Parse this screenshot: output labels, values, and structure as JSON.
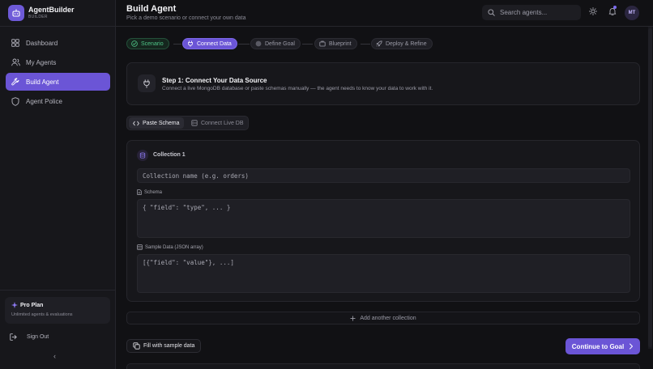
{
  "brand": {
    "name": "AgentBuilder",
    "subtitle": "BUILDER"
  },
  "sidebar": {
    "items": [
      {
        "label": "Dashboard",
        "icon": "dashboard-icon",
        "active": false
      },
      {
        "label": "My Agents",
        "icon": "users-icon",
        "active": false
      },
      {
        "label": "Build Agent",
        "icon": "wrench-icon",
        "active": true
      },
      {
        "label": "Agent Police",
        "icon": "shield-icon",
        "active": false
      }
    ],
    "pro": {
      "title": "Pro Plan",
      "subtitle": "Unlimited agents & evaluations"
    },
    "signout": "Sign Out",
    "collapse": "‹"
  },
  "header": {
    "title": "Build Agent",
    "subtitle": "Pick a demo scenario or connect your own data",
    "search_placeholder": "Search agents...",
    "avatar": "MT"
  },
  "stepper": [
    {
      "label": "Scenario",
      "state": "done",
      "icon": "check-circle-icon"
    },
    {
      "label": "Connect Data",
      "state": "active",
      "icon": "plug-icon"
    },
    {
      "label": "Define Goal",
      "state": "pending",
      "icon": "circle-icon"
    },
    {
      "label": "Blueprint",
      "state": "pending",
      "icon": "blueprint-icon"
    },
    {
      "label": "Deploy & Refine",
      "state": "pending",
      "icon": "rocket-icon"
    }
  ],
  "step_card": {
    "title": "Step 1: Connect Your Data Source",
    "description": "Connect a live MongoDB database or paste schemas manually — the agent needs to know your data to work with it."
  },
  "tabs": [
    {
      "label": "Paste Schema",
      "active": true,
      "icon": "code-icon"
    },
    {
      "label": "Connect Live DB",
      "active": false,
      "icon": "database-icon"
    }
  ],
  "collection": {
    "title": "Collection 1",
    "name_placeholder": "Collection name (e.g. orders)",
    "schema_label": "Schema",
    "schema_placeholder": "{ \"field\": \"type\", ... }",
    "sample_label": "Sample Data (JSON array)",
    "sample_placeholder": "[{\"field\": \"value\"}, ...]"
  },
  "actions": {
    "add_collection": "Add another collection",
    "fill_sample": "Fill with sample data",
    "continue": "Continue to Goal"
  },
  "colors": {
    "accent": "#6b55d6",
    "success": "#4fc487",
    "background": "#111114",
    "panel": "#17171b"
  }
}
